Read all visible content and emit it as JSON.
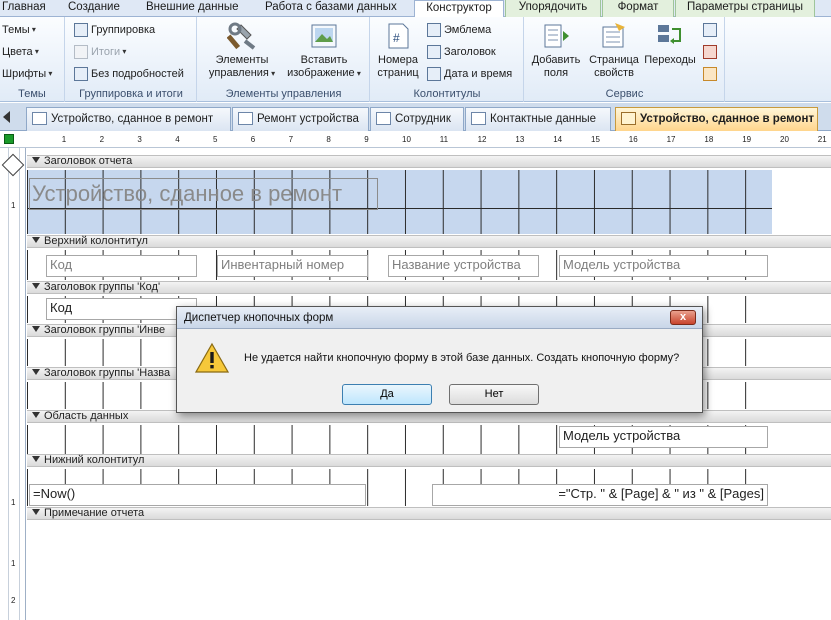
{
  "ribbon_tabs": [
    "Главная",
    "Создание",
    "Внешние данные",
    "Работа с базами данных",
    "Конструктор",
    "Упорядочить",
    "Формат",
    "Параметры страницы"
  ],
  "active_tab": "Конструктор",
  "ribbon": {
    "themes": {
      "themes_label": "Темы",
      "colors_label": "Цвета",
      "fonts_label": "Шрифты",
      "group_label": "Темы"
    },
    "grouping": {
      "group_label_btn": "Группировка",
      "totals_label": "Итоги",
      "hide_details_label": "Без подробностей",
      "group_label": "Группировка и итоги"
    },
    "controls": {
      "elements_line1": "Элементы",
      "elements_line2": "управления",
      "insert_line1": "Вставить",
      "insert_line2": "изображение",
      "group_label": "Элементы управления"
    },
    "headerfooter": {
      "page_numbers_line1": "Номера",
      "page_numbers_line2": "страниц",
      "logo_label": "Эмблема",
      "title_label": "Заголовок",
      "datetime_label": "Дата и время",
      "group_label": "Колонтитулы"
    },
    "tools": {
      "add_fields_line1": "Добавить",
      "add_fields_line2": "поля",
      "property_sheet_line1": "Страница",
      "property_sheet_line2": "свойств",
      "transitions_label": "Переходы",
      "group_label": "Сервис"
    }
  },
  "document_tabs": [
    {
      "label": "Устройство, сданное в ремонт",
      "active": false
    },
    {
      "label": "Ремонт устройства",
      "active": false
    },
    {
      "label": "Сотрудник",
      "active": false
    },
    {
      "label": "Контактные данные",
      "active": false
    },
    {
      "label": "Устройство, сданное в ремонт",
      "active": true
    }
  ],
  "ruler_ticks": [
    "1",
    "2",
    "3",
    "4",
    "5",
    "6",
    "7",
    "8",
    "9",
    "10",
    "11",
    "12",
    "13",
    "14",
    "15",
    "16",
    "17",
    "18",
    "19",
    "20",
    "21"
  ],
  "vertical_ruler": [
    "1",
    "1",
    "1",
    "2"
  ],
  "report": {
    "sections": {
      "report_header": "Заголовок отчета",
      "page_header": "Верхний колонтитул",
      "group_header_code": "Заголовок группы 'Код'",
      "group_header_inv": "Заголовок группы 'Инве",
      "group_header_name": "Заголовок группы 'Назва",
      "detail": "Область данных",
      "page_footer": "Нижний колонтитул",
      "report_footer": "Примечание отчета"
    },
    "title": "Устройство, сданное в ремонт",
    "page_header_labels": [
      "Код",
      "Инвентарный номер",
      "Название устройства",
      "Модель устройства"
    ],
    "group_code_field": "Код",
    "detail_field": "Модель устройства",
    "footer_now": "=Now()",
    "footer_pages": "=\"Стр. \" & [Page] & \" из \" & [Pages]"
  },
  "dialog": {
    "title": "Диспетчер кнопочных форм",
    "close_label": "x",
    "message": "Не удается найти кнопочную форму в этой базе данных.  Создать кнопочную форму?",
    "yes_label": "Да",
    "no_label": "Нет"
  }
}
